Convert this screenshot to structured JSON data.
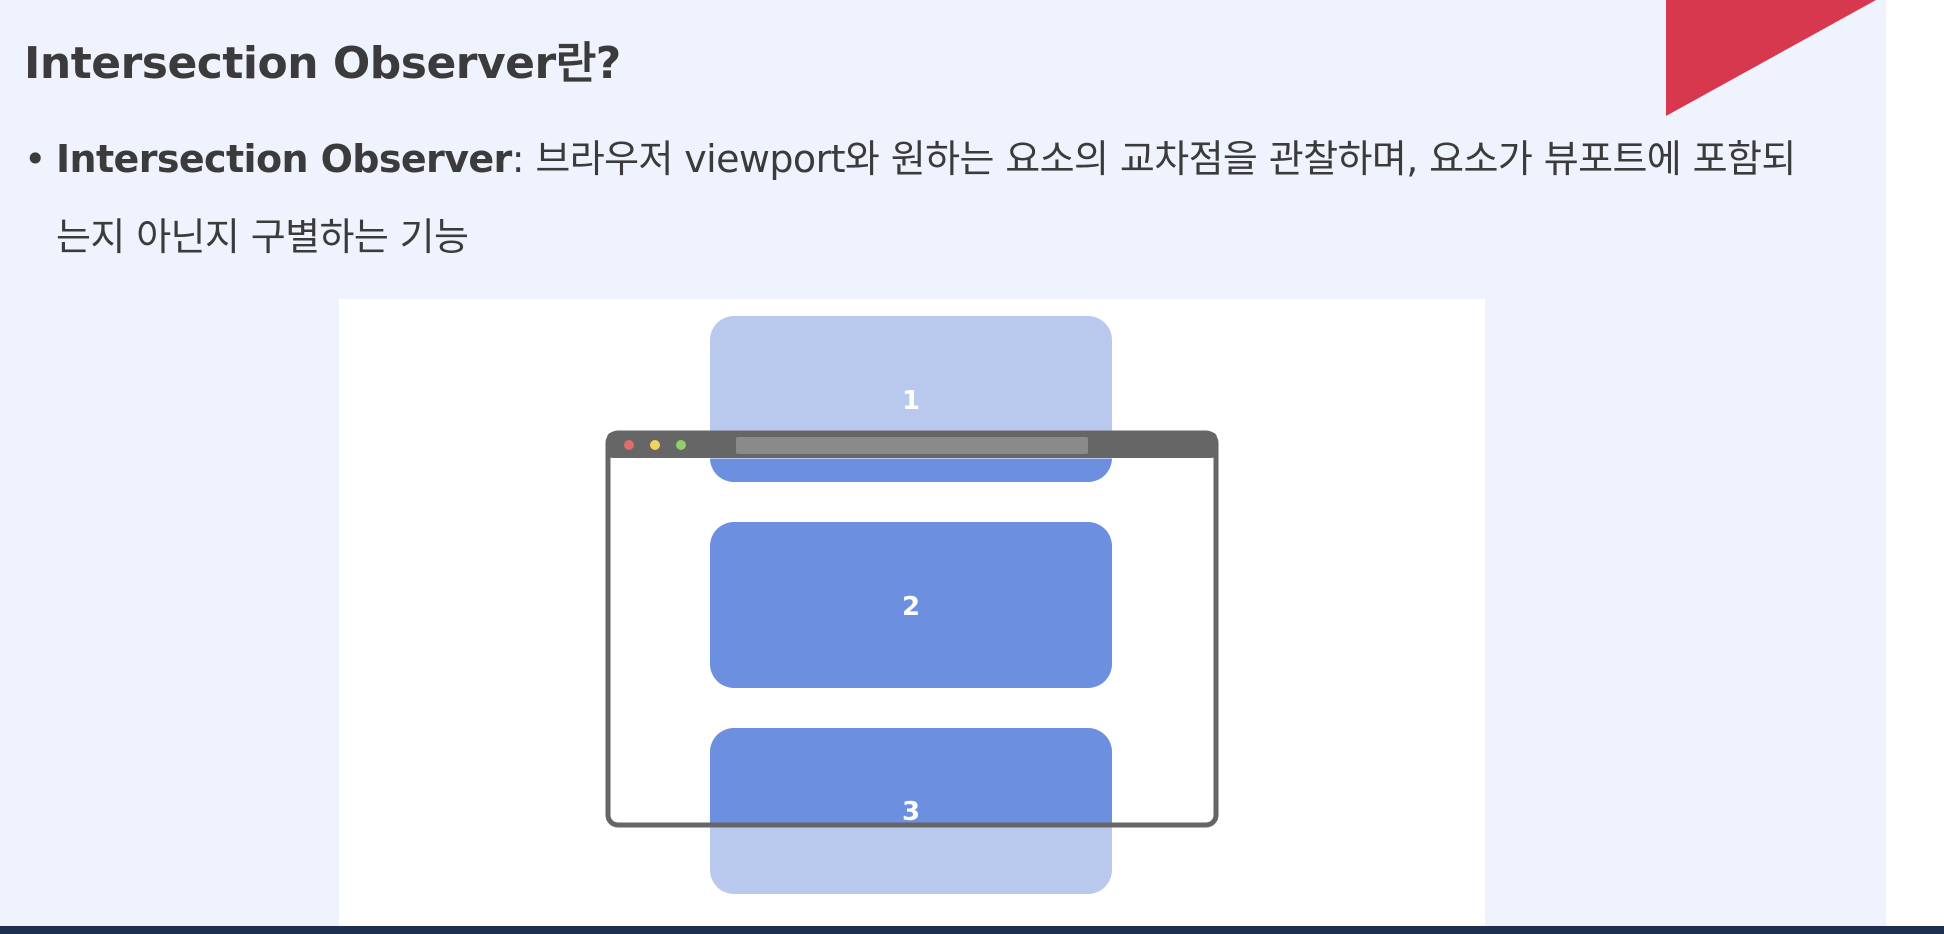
{
  "slide": {
    "title": "Intersection Observer란?",
    "bullet": {
      "marker": "•",
      "term": "Intersection Observer",
      "description": ": 브라우저 viewport와 원하는 요소의 교차점을 관찰하며, 요소가 뷰포트에 포함되는지 아닌지 구별하는 기능"
    }
  },
  "figure": {
    "boxes": [
      {
        "label": "1",
        "state": "partially-visible"
      },
      {
        "label": "2",
        "state": "fully-visible"
      },
      {
        "label": "3",
        "state": "partially-visible"
      }
    ],
    "colors": {
      "box_visible": "#6d8fdf",
      "box_outside": "#b9c9ee",
      "browser_frame": "#666666",
      "dot_red": "#e06c6c",
      "dot_yellow": "#f2d35c",
      "dot_green": "#8fd06a",
      "address_bar": "#8a8a8a"
    }
  },
  "decor": {
    "accent_color": "#d8384d"
  }
}
